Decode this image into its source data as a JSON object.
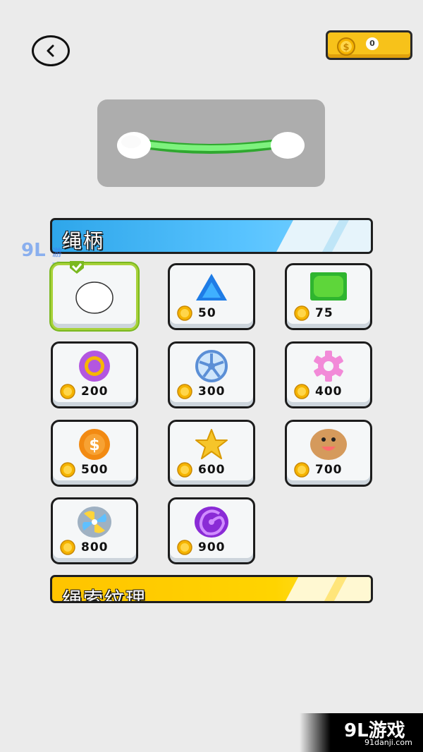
{
  "header": {
    "coins": "0"
  },
  "section1": {
    "title": "绳柄"
  },
  "section2": {
    "title": "绳索纹理"
  },
  "items": [
    {
      "name": "white-circle",
      "price": "",
      "selected": true
    },
    {
      "name": "blue-triangle",
      "price": "50"
    },
    {
      "name": "green-square",
      "price": "75"
    },
    {
      "name": "purple-sun",
      "price": "200"
    },
    {
      "name": "wheel",
      "price": "300"
    },
    {
      "name": "pink-gear",
      "price": "400"
    },
    {
      "name": "dollar-coin",
      "price": "500"
    },
    {
      "name": "star",
      "price": "600"
    },
    {
      "name": "cookie-face",
      "price": "700"
    },
    {
      "name": "fan",
      "price": "800"
    },
    {
      "name": "purple-swirl",
      "price": "900"
    }
  ],
  "watermark": {
    "top_left": "9L",
    "top_left_sub": "游戏",
    "bottom_title": "9L游戏",
    "bottom_url": "91danji.com"
  },
  "colors": {
    "accent_blue": "#2ea6ea",
    "accent_yellow": "#ffc400",
    "coin": "#f5b400",
    "rope": "#6ef06e"
  }
}
